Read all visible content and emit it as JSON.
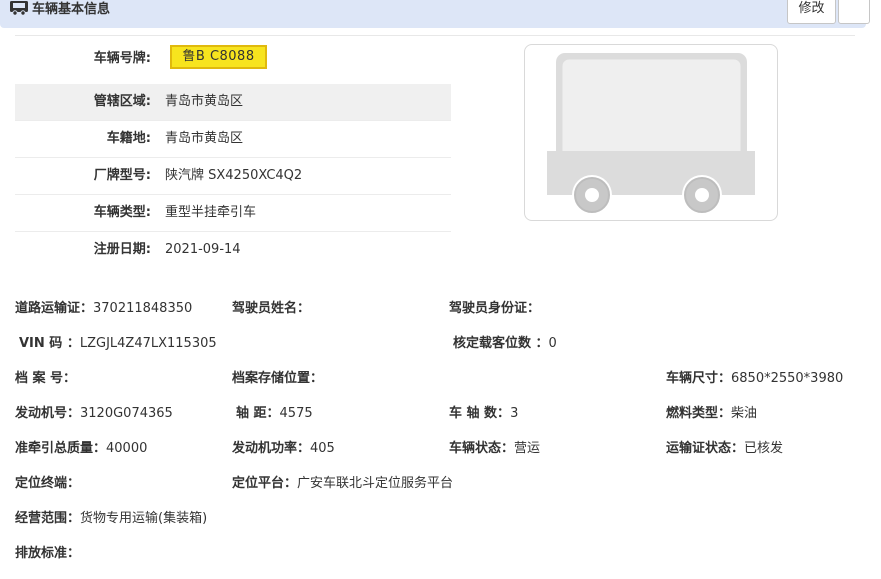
{
  "header": {
    "title": "车辆基本信息",
    "edit_label": "修改"
  },
  "plate_info": [
    {
      "label": "车辆号牌:",
      "value": "鲁B C8088"
    },
    {
      "label": "管辖区域:",
      "value": "青岛市黄岛区"
    },
    {
      "label": "车籍地:",
      "value": "青岛市黄岛区"
    },
    {
      "label": "厂牌型号:",
      "value": "陕汽牌 SX4250XC4Q2"
    },
    {
      "label": "车辆类型:",
      "value": "重型半挂牵引车"
    },
    {
      "label": "注册日期:",
      "value": "2021-09-14"
    }
  ],
  "details": {
    "road_permit": {
      "label": "道路运输证：",
      "value": "370211848350"
    },
    "driver_name": {
      "label": "驾驶员姓名：",
      "value": ""
    },
    "driver_id": {
      "label": "驾驶员身份证：",
      "value": ""
    },
    "vin": {
      "label": "VIN 码 ：",
      "value": "LZGJL4Z47LX115305"
    },
    "seats": {
      "label": "核定载客位数 ：",
      "value": "0"
    },
    "file_no": {
      "label": "档 案 号：",
      "value": ""
    },
    "file_location": {
      "label": "档案存储位置：",
      "value": ""
    },
    "size": {
      "label": "车辆尺寸：",
      "value": "6850*2550*3980"
    },
    "engine_no": {
      "label": "发动机号：",
      "value": "3120G074365"
    },
    "wheelbase": {
      "label": "轴 距：",
      "value": "4575"
    },
    "axles": {
      "label": "车 轴 数：",
      "value": "3"
    },
    "fuel": {
      "label": "燃料类型：",
      "value": "柴油"
    },
    "tow_mass": {
      "label": "准牵引总质量：",
      "value": "40000"
    },
    "engine_power": {
      "label": "发动机功率：",
      "value": "405"
    },
    "status": {
      "label": "车辆状态：",
      "value": "营运"
    },
    "permit_status": {
      "label": "运输证状态：",
      "value": "已核发"
    },
    "terminal": {
      "label": "定位终端：",
      "value": ""
    },
    "platform": {
      "label": "定位平台：",
      "value": "广安车联北斗定位服务平台"
    },
    "scope": {
      "label": "经营范围：",
      "value": "货物专用运输(集装箱)"
    },
    "emission": {
      "label": "排放标准：",
      "value": ""
    }
  },
  "icons": {
    "title": "truck-icon",
    "photo": "vehicle-placeholder-icon"
  }
}
